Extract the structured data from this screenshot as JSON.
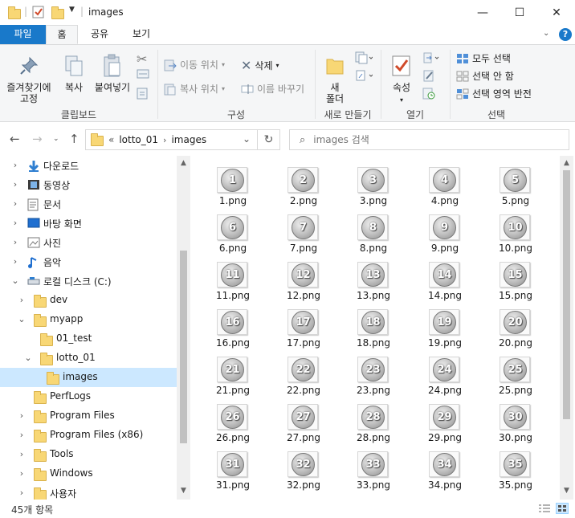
{
  "window": {
    "title": "images",
    "minimize": "—",
    "maximize": "☐",
    "close": "✕"
  },
  "ribbon_tabs": [
    "파일",
    "홈",
    "공유",
    "보기"
  ],
  "ribbon": {
    "clipboard": {
      "pin": "즐겨찾기에\n고정",
      "copy": "복사",
      "paste": "붙여넣기",
      "group": "클립보드"
    },
    "organize": {
      "move_to": "이동 위치",
      "copy_to": "복사 위치",
      "delete": "삭제",
      "rename": "이름 바꾸기",
      "group": "구성"
    },
    "new": {
      "new_folder": "새\n폴더",
      "group": "새로 만들기"
    },
    "open": {
      "properties": "속성",
      "group": "열기"
    },
    "select": {
      "select_all": "모두 선택",
      "select_none": "선택 안 함",
      "invert": "선택 영역 반전",
      "group": "선택"
    }
  },
  "address": {
    "prefix": "«",
    "crumbs": [
      "lotto_01",
      "images"
    ],
    "search_placeholder": "images 검색"
  },
  "nav_tree": [
    {
      "label": "다운로드",
      "icon": "download-icon",
      "chev": "›"
    },
    {
      "label": "동영상",
      "icon": "video-icon",
      "chev": "›"
    },
    {
      "label": "문서",
      "icon": "document-icon",
      "chev": "›"
    },
    {
      "label": "바탕 화면",
      "icon": "desktop-icon",
      "chev": "›"
    },
    {
      "label": "사진",
      "icon": "pictures-icon",
      "chev": "›"
    },
    {
      "label": "음악",
      "icon": "music-icon",
      "chev": "›"
    },
    {
      "label": "로컬 디스크 (C:)",
      "icon": "drive-icon",
      "chev": "⌄"
    },
    {
      "label": "dev",
      "icon": "folder-icon",
      "chev": "›"
    },
    {
      "label": "myapp",
      "icon": "folder-icon",
      "chev": "⌄"
    },
    {
      "label": "01_test",
      "icon": "folder-icon",
      "chev": ""
    },
    {
      "label": "lotto_01",
      "icon": "folder-icon",
      "chev": "⌄"
    },
    {
      "label": "images",
      "icon": "folder-icon",
      "chev": ""
    },
    {
      "label": "PerfLogs",
      "icon": "folder-icon",
      "chev": ""
    },
    {
      "label": "Program Files",
      "icon": "folder-icon",
      "chev": "›"
    },
    {
      "label": "Program Files (x86)",
      "icon": "folder-icon",
      "chev": "›"
    },
    {
      "label": "Tools",
      "icon": "folder-icon",
      "chev": "›"
    },
    {
      "label": "Windows",
      "icon": "folder-icon",
      "chev": "›"
    },
    {
      "label": "사용자",
      "icon": "folder-icon",
      "chev": "›"
    }
  ],
  "files": [
    {
      "num": "1",
      "name": "1.png"
    },
    {
      "num": "2",
      "name": "2.png"
    },
    {
      "num": "3",
      "name": "3.png"
    },
    {
      "num": "4",
      "name": "4.png"
    },
    {
      "num": "5",
      "name": "5.png"
    },
    {
      "num": "6",
      "name": "6.png"
    },
    {
      "num": "7",
      "name": "7.png"
    },
    {
      "num": "8",
      "name": "8.png"
    },
    {
      "num": "9",
      "name": "9.png"
    },
    {
      "num": "10",
      "name": "10.png"
    },
    {
      "num": "11",
      "name": "11.png"
    },
    {
      "num": "12",
      "name": "12.png"
    },
    {
      "num": "13",
      "name": "13.png"
    },
    {
      "num": "14",
      "name": "14.png"
    },
    {
      "num": "15",
      "name": "15.png"
    },
    {
      "num": "16",
      "name": "16.png"
    },
    {
      "num": "17",
      "name": "17.png"
    },
    {
      "num": "18",
      "name": "18.png"
    },
    {
      "num": "19",
      "name": "19.png"
    },
    {
      "num": "20",
      "name": "20.png"
    },
    {
      "num": "21",
      "name": "21.png"
    },
    {
      "num": "22",
      "name": "22.png"
    },
    {
      "num": "23",
      "name": "23.png"
    },
    {
      "num": "24",
      "name": "24.png"
    },
    {
      "num": "25",
      "name": "25.png"
    },
    {
      "num": "26",
      "name": "26.png"
    },
    {
      "num": "27",
      "name": "27.png"
    },
    {
      "num": "28",
      "name": "28.png"
    },
    {
      "num": "29",
      "name": "29.png"
    },
    {
      "num": "30",
      "name": "30.png"
    },
    {
      "num": "31",
      "name": "31.png"
    },
    {
      "num": "32",
      "name": "32.png"
    },
    {
      "num": "33",
      "name": "33.png"
    },
    {
      "num": "34",
      "name": "34.png"
    },
    {
      "num": "35",
      "name": "35.png"
    }
  ],
  "status": {
    "count": "45개 항목"
  },
  "colors": {
    "file_tab": "#1979ca",
    "selected": "#cce8ff",
    "folder": "#f8d775"
  }
}
